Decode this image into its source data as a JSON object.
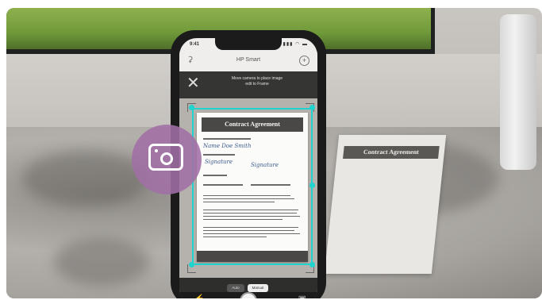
{
  "app": {
    "title": "HP Smart",
    "status_time": "9:41",
    "status_icons": "▮▮▮ ◠ ▬"
  },
  "camera": {
    "instruction": "Move camera to place image\nedit to Frame",
    "close_icon": "close-icon",
    "modes": {
      "auto_label": "Auto",
      "manual_label": "Manual"
    }
  },
  "document": {
    "title": "Contract Agreement",
    "signature_1": "Name  Doe  Smith",
    "signature_2": "Signature",
    "background_title": "Contract Agreement"
  },
  "icons": {
    "bell": "bell-icon",
    "add": "plus-icon",
    "flash": "flash-icon",
    "shutter": "shutter-button",
    "gallery": "gallery-icon",
    "badge": "camera-icon"
  },
  "colors": {
    "crop_frame": "#1fd3cf",
    "badge": "#a06ea5"
  }
}
